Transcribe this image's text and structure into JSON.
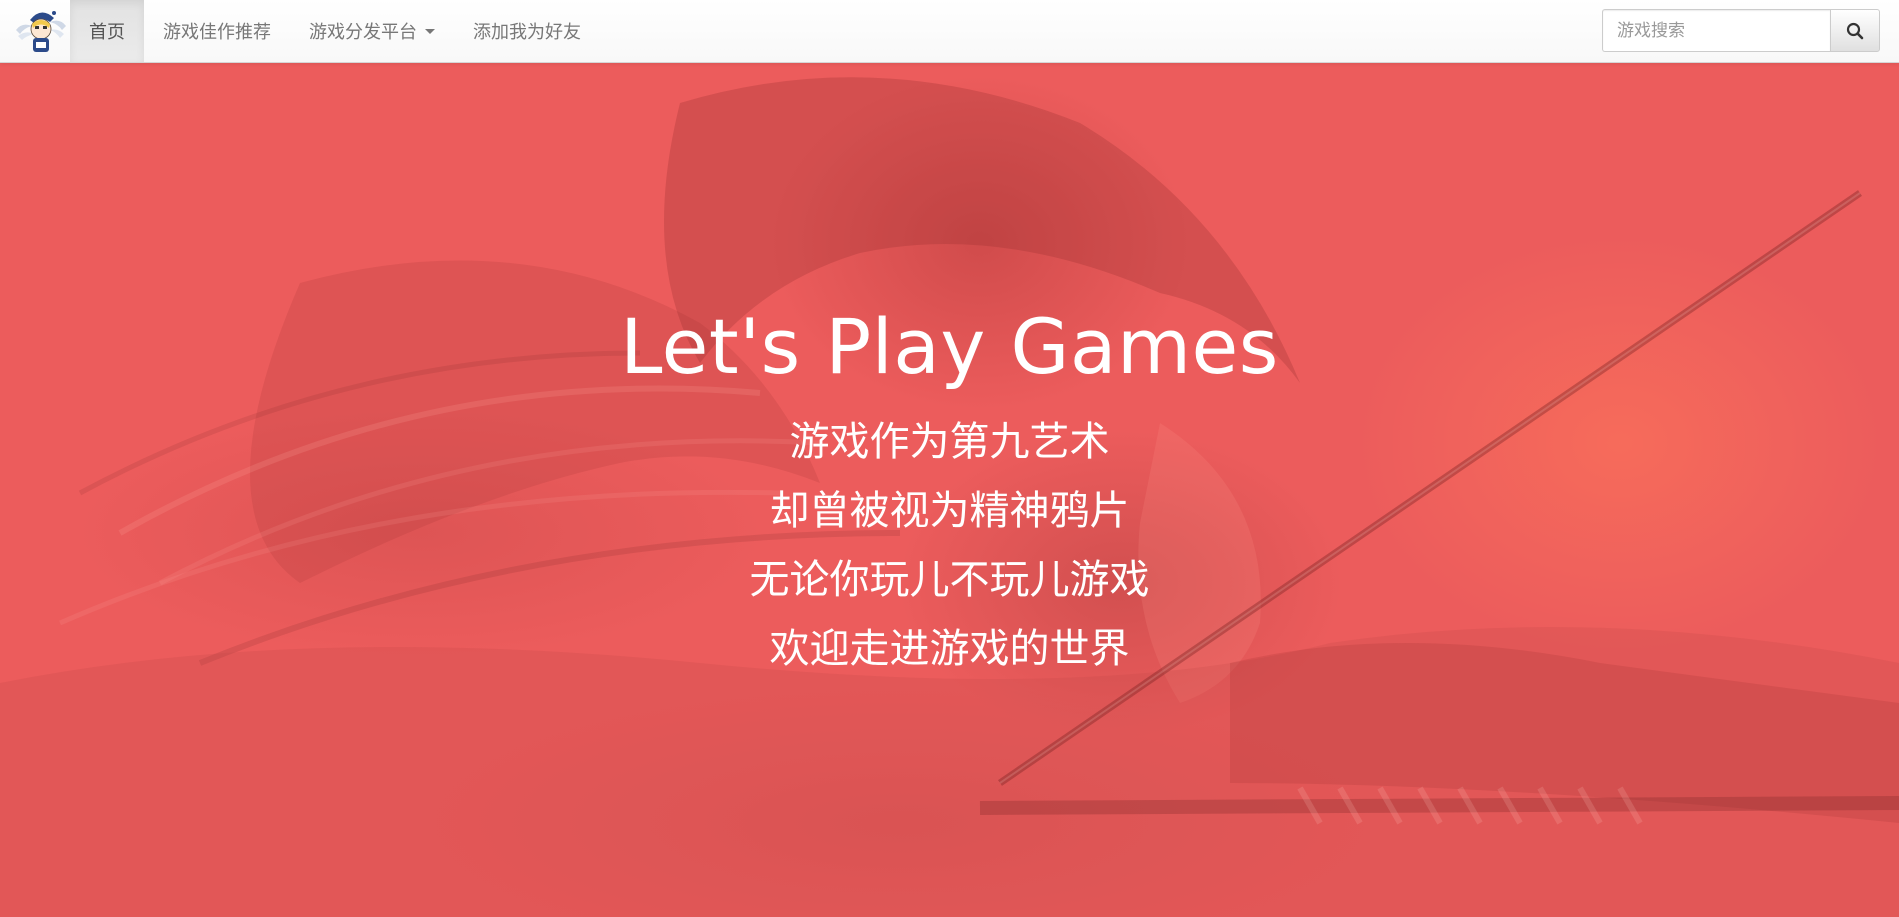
{
  "navbar": {
    "brand_icon": "mascot-logo-icon",
    "items": [
      {
        "label": "首页",
        "active": true
      },
      {
        "label": "游戏佳作推荐",
        "active": false
      },
      {
        "label": "游戏分发平台",
        "active": false,
        "dropdown": true
      },
      {
        "label": "添加我为好友",
        "active": false
      }
    ],
    "search": {
      "placeholder": "游戏搜索",
      "value": "",
      "button_icon": "search-icon"
    }
  },
  "hero": {
    "title": "Let's Play Games",
    "lines": [
      "游戏作为第九艺术",
      "却曾被视为精神鸦片",
      "无论你玩儿不玩儿游戏",
      "欢迎走进游戏的世界"
    ],
    "overlay_color": "#ec5c5c"
  },
  "colors": {
    "nav_text": "#777777",
    "nav_active_bg": "#e5e5e5",
    "hero_text": "#ffffff"
  }
}
